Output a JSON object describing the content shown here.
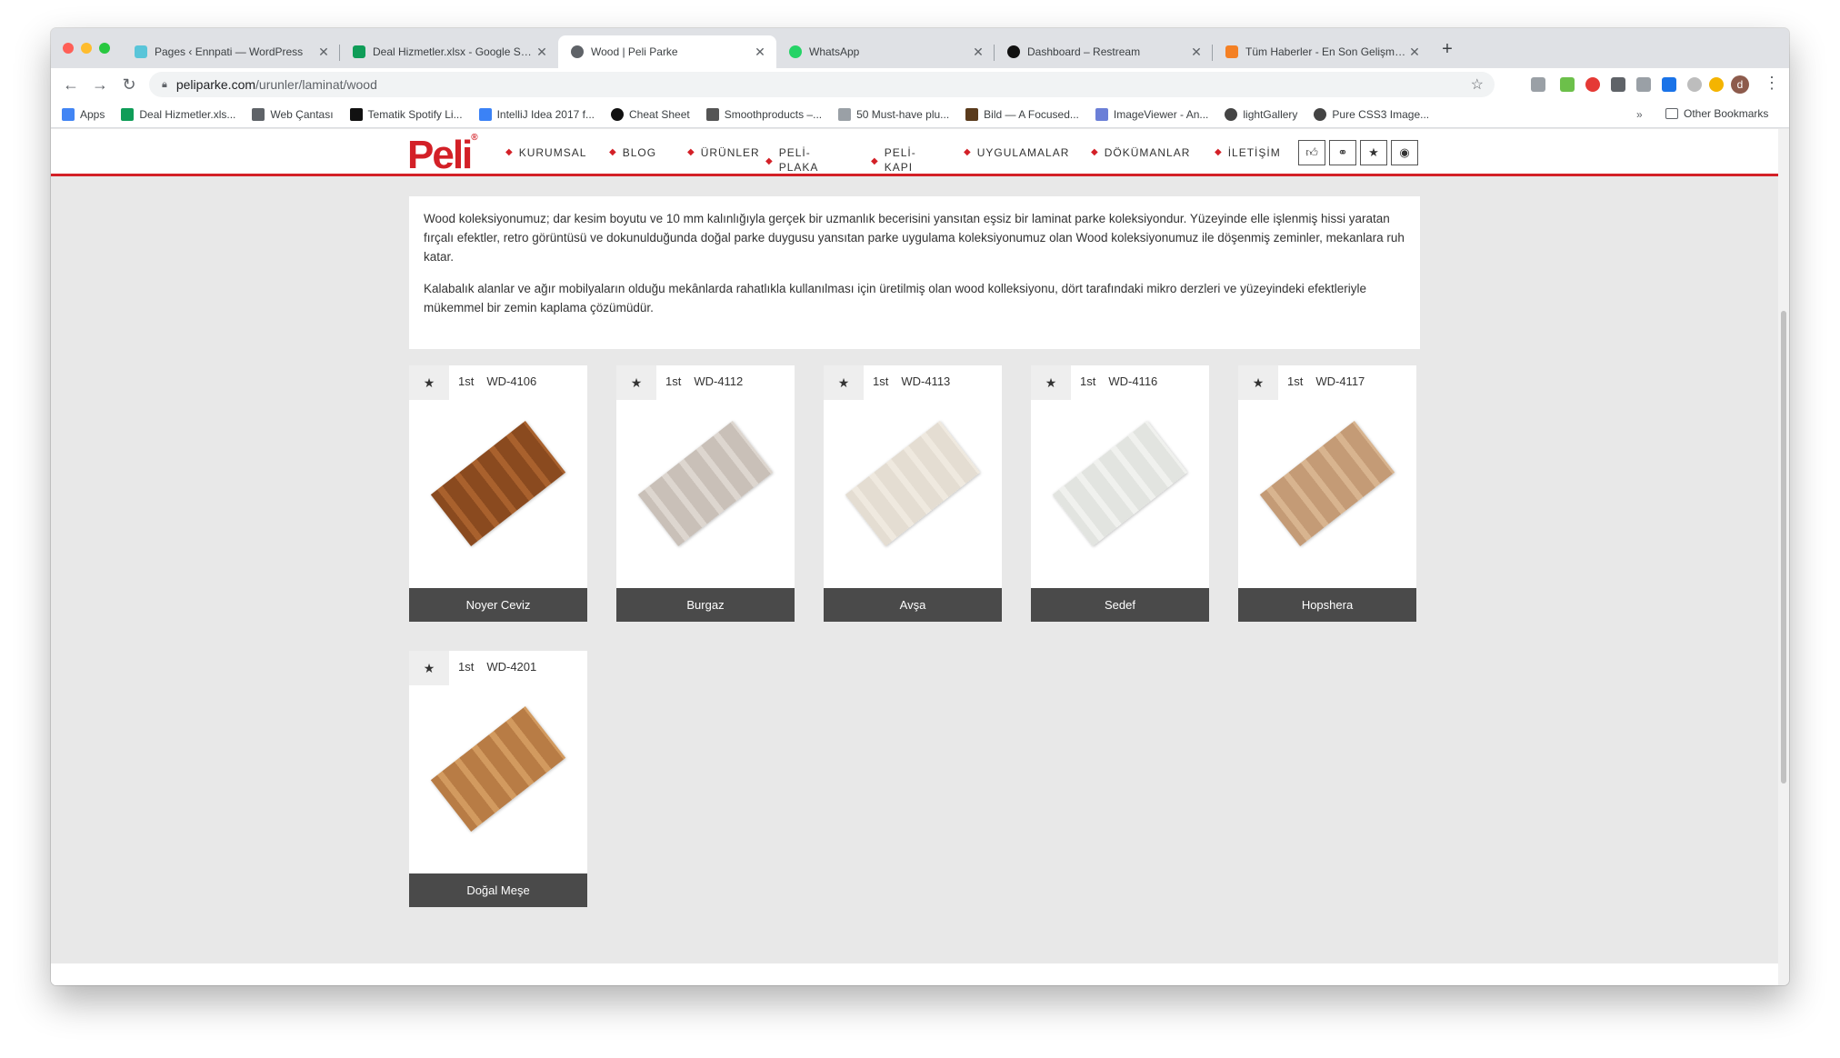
{
  "browser": {
    "tabs": [
      {
        "title": "Pages ‹ Ennpati — WordPress",
        "favicon_color": "#59c5d9",
        "active": false
      },
      {
        "title": "Deal Hizmetler.xlsx - Google Sheets",
        "favicon_color": "#0f9d58",
        "active": false
      },
      {
        "title": "Wood | Peli Parke",
        "favicon_color": "#5f6368",
        "active": true
      },
      {
        "title": "WhatsApp",
        "favicon_color": "#25d366",
        "active": false
      },
      {
        "title": "Dashboard – Restream",
        "favicon_color": "#111111",
        "active": false
      },
      {
        "title": "Tüm Haberler - En Son Gelişmeler",
        "favicon_color": "#f48024",
        "active": false
      }
    ],
    "url_host": "peliparke.com",
    "url_path": "/urunler/laminat/wood",
    "bookmarks": [
      {
        "label": "Apps",
        "icon_color": "#4285f4"
      },
      {
        "label": "Deal Hizmetler.xls...",
        "icon_color": "#0f9d58"
      },
      {
        "label": "Web Çantası",
        "icon_color": "#5f6368"
      },
      {
        "label": "Tematik Spotify Li...",
        "icon_color": "#111111"
      },
      {
        "label": "IntelliJ Idea 2017 f...",
        "icon_color": "#3b82f6"
      },
      {
        "label": "Cheat Sheet",
        "icon_color": "#111111"
      },
      {
        "label": "Smoothproducts –...",
        "icon_color": "#555555"
      },
      {
        "label": "50 Must-have plu...",
        "icon_color": "#9aa0a6"
      },
      {
        "label": "Bild — A Focused...",
        "icon_color": "#5a3b1c"
      },
      {
        "label": "ImageViewer - An...",
        "icon_color": "#6b7fd7"
      },
      {
        "label": "lightGallery",
        "icon_color": "#444444"
      },
      {
        "label": "Pure CSS3 Image...",
        "icon_color": "#444444"
      }
    ],
    "bookmarks_more": "»",
    "other_bookmarks": "Other Bookmarks",
    "avatar_letter": "d"
  },
  "site": {
    "logo": "Peli",
    "nav": [
      {
        "label": "KURUMSAL",
        "line2": ""
      },
      {
        "label": "BLOG",
        "line2": ""
      },
      {
        "label": "ÜRÜNLER",
        "line2": ""
      },
      {
        "label": "PELİ-",
        "line2": "PLAKA"
      },
      {
        "label": "PELİ-",
        "line2": "KAPI"
      },
      {
        "label": "UYGULAMALAR",
        "line2": ""
      },
      {
        "label": "DÖKÜMANLAR",
        "line2": ""
      },
      {
        "label": "İLETİŞİM",
        "line2": ""
      }
    ],
    "header_icons": [
      "thumbs-up-icon",
      "handshake-icon",
      "star-icon",
      "globe-icon"
    ],
    "description": [
      "Wood koleksiyonumuz; dar kesim boyutu ve 10 mm kalınlığıyla gerçek bir uzmanlık becerisini yansıtan eşsiz bir laminat parke koleksiyondur. Yüzeyinde elle işlenmiş hissi yaratan fırçalı efektler, retro görüntüsü ve dokunulduğunda doğal parke duygusu yansıtan parke uygulama koleksiyonumuz olan Wood koleksiyonumuz ile döşenmiş zeminler, mekanlara ruh katar.",
      "Kalabalık alanlar ve ağır mobilyaların olduğu mekânlarda rahatlıkla kullanılması için üretilmiş olan wood kolleksiyonu, dört tarafındaki mikro derzleri ve yüzeyindeki efektleriyle mükemmel bir zemin kaplama çözümüdür."
    ],
    "products": [
      {
        "quality": "1st",
        "code": "WD-4106",
        "name": "Noyer Ceviz",
        "color_a": "#8a4a1f",
        "color_b": "#a9612d"
      },
      {
        "quality": "1st",
        "code": "WD-4112",
        "name": "Burgaz",
        "color_a": "#c9c0b8",
        "color_b": "#ddd6cf"
      },
      {
        "quality": "1st",
        "code": "WD-4113",
        "name": "Avşa",
        "color_a": "#e4ddd2",
        "color_b": "#efe9df"
      },
      {
        "quality": "1st",
        "code": "WD-4116",
        "name": "Sedef",
        "color_a": "#e2e4e0",
        "color_b": "#f0f1ee"
      },
      {
        "quality": "1st",
        "code": "WD-4117",
        "name": "Hopshera",
        "color_a": "#c49b76",
        "color_b": "#d8b48f"
      },
      {
        "quality": "1st",
        "code": "WD-4201",
        "name": "Doğal Meşe",
        "color_a": "#b87c45",
        "color_b": "#d29a5f"
      }
    ]
  }
}
